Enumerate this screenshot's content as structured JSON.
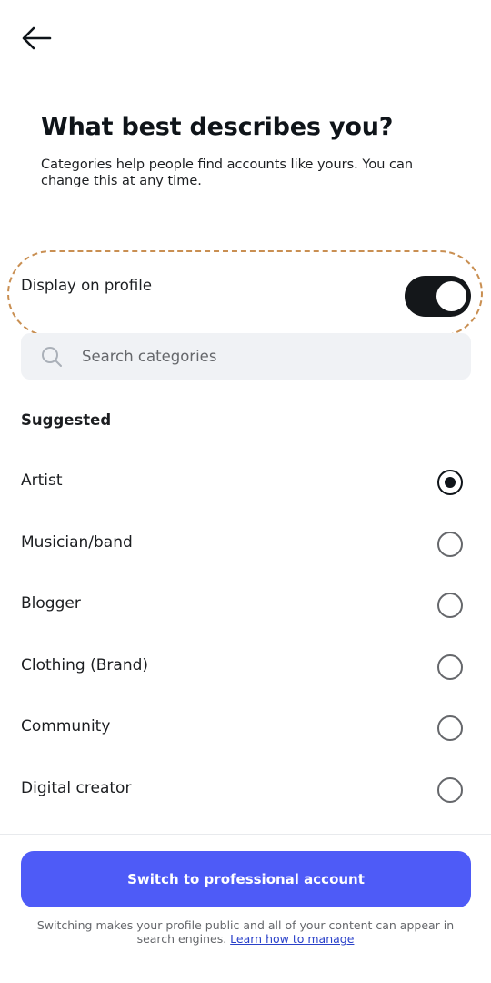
{
  "header": {
    "back_icon": "arrow-left-icon",
    "title": "What best describes you?",
    "subtitle": "Categories help people find accounts like yours. You can change this at any time."
  },
  "display_toggle": {
    "label": "Display on profile",
    "on": true
  },
  "search": {
    "placeholder": "Search categories",
    "value": "",
    "icon": "search-icon"
  },
  "suggested": {
    "heading": "Suggested",
    "items": [
      {
        "label": "Artist",
        "selected": true
      },
      {
        "label": "Musician/band",
        "selected": false
      },
      {
        "label": "Blogger",
        "selected": false
      },
      {
        "label": "Clothing (Brand)",
        "selected": false
      },
      {
        "label": "Community",
        "selected": false
      },
      {
        "label": "Digital creator",
        "selected": false
      }
    ]
  },
  "footer": {
    "button_label": "Switch to professional account",
    "note_text": "Switching makes your profile public and all of your content can appear in search engines.",
    "link_text": "Learn how to manage"
  },
  "colors": {
    "primary": "#4e5bf7",
    "highlight": "#c98f52",
    "toggle_on": "#14171a",
    "link": "#2a41c9"
  }
}
